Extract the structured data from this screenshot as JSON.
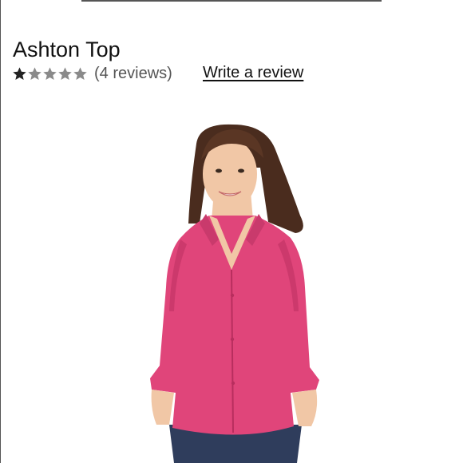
{
  "product": {
    "title": "Ashton Top",
    "rating": {
      "value": 1,
      "max": 5,
      "filled_color": "#222222",
      "empty_color": "#8a8a8a"
    },
    "reviews_label": "(4 reviews)",
    "write_review_label": "Write a review"
  },
  "image": {
    "icon": "product-photo",
    "colors": {
      "shirt": "#e0457a",
      "shirt_shadow": "#b82e5e",
      "hair": "#4a2c1e",
      "skin": "#f1c7a6",
      "jeans": "#2f3d5c"
    }
  }
}
